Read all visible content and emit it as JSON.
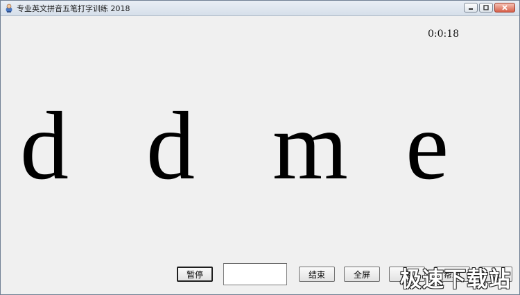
{
  "window": {
    "title": "专业英文拼音五笔打字训练 2018"
  },
  "timer": "0:0:18",
  "letters": [
    "d",
    "d",
    "m",
    "e"
  ],
  "buttons": {
    "pause": "暂停",
    "end": "结束",
    "fullscreen": "全屏",
    "partial_1": "退",
    "help": "帮助",
    "partial_2": "出"
  },
  "input": {
    "value": ""
  },
  "watermark": "极速下载站"
}
